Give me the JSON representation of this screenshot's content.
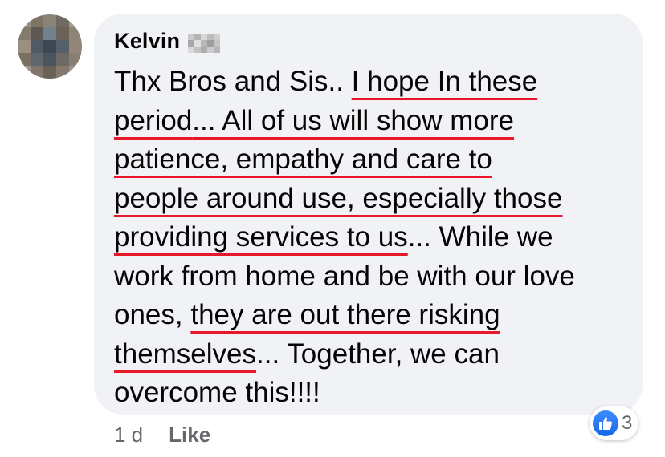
{
  "comment": {
    "author": "Kelvin",
    "lines": [
      [
        {
          "t": "Thx Bros and Sis.. ",
          "u": false
        },
        {
          "t": "I hope In these",
          "u": true
        }
      ],
      [
        {
          "t": "period",
          "u": true
        },
        {
          "t": "... All of us will show more",
          "u": true
        }
      ],
      [
        {
          "t": "patience, empathy and care to",
          "u": true
        }
      ],
      [
        {
          "t": "people around use, especially those",
          "u": true
        }
      ],
      [
        {
          "t": "providing services to us",
          "u": true
        },
        {
          "t": "... While we",
          "u": false
        }
      ],
      [
        {
          "t": "work from home and be with our love",
          "u": false
        }
      ],
      [
        {
          "t": "ones, ",
          "u": false
        },
        {
          "t": "they are out there risking",
          "u": true
        }
      ],
      [
        {
          "t": "themselves",
          "u": true
        },
        {
          "t": "... Together, we can",
          "u": false
        }
      ],
      [
        {
          "t": "overcome this!!!!",
          "u": false
        }
      ]
    ]
  },
  "footer": {
    "timestamp": "1 d",
    "like_label": "Like"
  },
  "reactions": {
    "icon": "thumbs-up-icon",
    "count": "3",
    "color": "#1877f2"
  },
  "colors": {
    "bubble": "#f0f2f5",
    "underline": "#e8182a",
    "meta_text": "#65676b"
  },
  "avatar": {
    "pixel_colors": [
      "#9a9186",
      "#7d7466",
      "#8c8378",
      "#6e6a62",
      "#a39a8d",
      "#857b6d",
      "#5c5852",
      "#73818f",
      "#6b6156",
      "#8e8579",
      "#9b8f80",
      "#4e5a64",
      "#3d4753",
      "#56606a",
      "#938677",
      "#7a6f62",
      "#60676c",
      "#4a5560",
      "#6d6a64",
      "#8a7e70",
      "#a0968a",
      "#7f7568",
      "#6a6157",
      "#857a6d",
      "#9d9386"
    ]
  },
  "name_blur": {
    "pixel_colors": [
      "#c9c9c9",
      "#b3b3b3",
      "#d6d6d6",
      "#bdbdbd",
      "#cfcfcf",
      "#a8a8a8",
      "#e0e0e0",
      "#b8b8b8",
      "#9e9e9e",
      "#c4c4c4",
      "#d9d9d9",
      "#c2c2c2",
      "#adadad",
      "#cccccc",
      "#b5b5b5"
    ]
  }
}
